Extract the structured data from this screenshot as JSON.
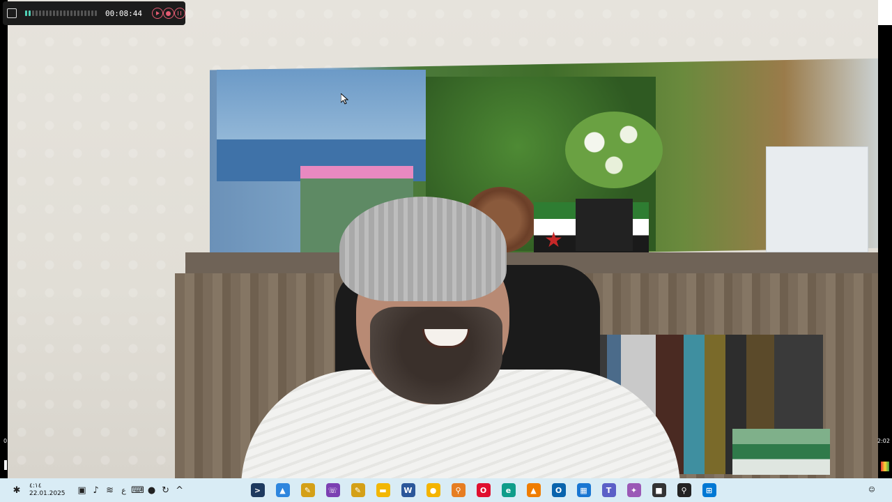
{
  "recorder": {
    "timer": "00:08:44",
    "meter_levels": [
      1,
      1,
      0,
      0,
      0,
      0,
      0,
      0,
      0,
      0,
      0,
      0,
      0,
      0,
      0,
      0,
      0,
      0,
      0,
      0,
      0
    ]
  },
  "taskbar": {
    "time": "٤:١٤",
    "date": "22.01.2025",
    "input_indicator": "ع",
    "apps": [
      {
        "name": "terminal-app-icon",
        "glyph": ">",
        "color": "#1e3a5f"
      },
      {
        "name": "photos-app-icon",
        "glyph": "▲",
        "color": "#2e86de"
      },
      {
        "name": "notes-app-icon",
        "glyph": "✎",
        "color": "#d4a017"
      },
      {
        "name": "viber-app-icon",
        "glyph": "☏",
        "color": "#7b3fb2"
      },
      {
        "name": "notepad-app-icon",
        "glyph": "✎",
        "color": "#d4a017"
      },
      {
        "name": "file-explorer-app-icon",
        "glyph": "▬",
        "color": "#f2b705"
      },
      {
        "name": "word-app-icon",
        "glyph": "W",
        "color": "#2b579a"
      },
      {
        "name": "chrome-app-icon",
        "glyph": "●",
        "color": "#f4b400"
      },
      {
        "name": "search-app-icon",
        "glyph": "⚲",
        "color": "#e67e22"
      },
      {
        "name": "opera-app-icon",
        "glyph": "O",
        "color": "#e0102f"
      },
      {
        "name": "edge-app-icon",
        "glyph": "e",
        "color": "#0f9d8a"
      },
      {
        "name": "vlc-app-icon",
        "glyph": "▲",
        "color": "#ef7d00"
      },
      {
        "name": "outlook-app-icon",
        "glyph": "O",
        "color": "#0a64ad"
      },
      {
        "name": "store-app-icon",
        "glyph": "▦",
        "color": "#1976d2"
      },
      {
        "name": "teams-app-icon",
        "glyph": "T",
        "color": "#5b5fc7"
      },
      {
        "name": "copilot-app-icon",
        "glyph": "✦",
        "color": "#9b59b6"
      },
      {
        "name": "task-view-app-icon",
        "glyph": "■",
        "color": "#333333"
      },
      {
        "name": "taskbar-search-icon",
        "glyph": "⚲",
        "color": "#222222"
      },
      {
        "name": "start-button-icon",
        "glyph": "⊞",
        "color": "#0078d4"
      }
    ]
  },
  "side_clocks": {
    "left": "0",
    "right": "2:02"
  },
  "colors": {
    "taskbar_bg": "#d9ecf5",
    "recorder_bg": "#1c1c1c",
    "accent_red": "#e45b72",
    "meter_on": "#4fd1b6"
  }
}
